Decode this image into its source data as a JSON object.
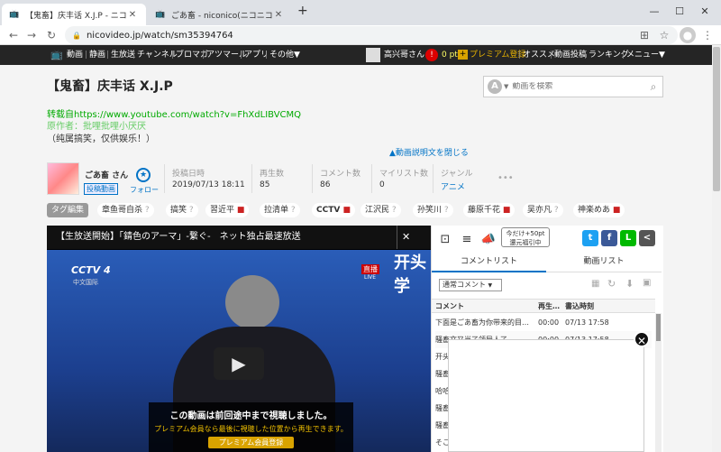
{
  "browser": {
    "tabs": [
      {
        "title": "【鬼畜】庆丰话 X.J.P - ニコニコ動画",
        "active": true
      },
      {
        "title": "ごあ畜 - niconico(ニコニコ)",
        "active": false
      }
    ],
    "new_tab": "+",
    "url": "nicovideo.jp/watch/sm35394764"
  },
  "nico_header": {
    "nav": [
      "動画",
      "静画",
      "生放送",
      "チャンネル",
      "ブロマガ",
      "アツマール",
      "アプリ",
      "その他▼"
    ],
    "user": "高兴哥さん",
    "points": "0 pt",
    "premium": "プレミアム登録",
    "right_nav": [
      "オススメ",
      "動画投稿",
      "ランキング",
      "メニュー▼"
    ]
  },
  "video": {
    "title": "【鬼畜】庆丰话 X.J.P",
    "search_placeholder": "動画を検索",
    "desc_source": "转载自https://www.youtube.com/watch?v=FhXdLIBVCMQ",
    "desc_author": "原作者：批哩批哩小厌厌",
    "desc_note": "（纯属搞笑，仅供娱乐！）",
    "close_desc": "▲動画説明文を閉じる"
  },
  "uploader": {
    "name": "ごあ畜 さん",
    "badge": "投稿動画",
    "follow": "フォロー"
  },
  "stats": [
    {
      "label": "投稿日時",
      "value": "2019/07/13 18:11"
    },
    {
      "label": "再生数",
      "value": "85"
    },
    {
      "label": "コメント数",
      "value": "86"
    },
    {
      "label": "マイリスト数",
      "value": "0"
    },
    {
      "label": "ジャンル",
      "value": "アニメ"
    }
  ],
  "more": "•••",
  "tags": {
    "edit_label": "タグ編集",
    "items": [
      {
        "label": "章鱼哥自杀",
        "lock": false
      },
      {
        "label": "搞笑",
        "lock": false
      },
      {
        "label": "習近平",
        "lock": true
      },
      {
        "label": "拉清单",
        "lock": false
      },
      {
        "label": "CCTV",
        "lock": true
      },
      {
        "label": "江沢民",
        "lock": false
      },
      {
        "label": "孙笑川",
        "lock": false
      },
      {
        "label": "藤原千花",
        "lock": true
      },
      {
        "label": "吴亦凡",
        "lock": false
      },
      {
        "label": "神楽めあ",
        "lock": true
      }
    ]
  },
  "player": {
    "banner": "【生放送開始】「錆色のアーマ」-繋ぐ-　ネット独占最速放送",
    "banner_close": "✕",
    "channel_logo": "CCTV 4",
    "channel_sub": "中文国际",
    "live_label": "直播",
    "live_sub": "LIVE",
    "overlay_text": "开头学",
    "resume_title": "この動画は前回途中まで視聴しました。",
    "resume_sub": "プレミアム会員なら最後に視聴した位置から再生できます。",
    "resume_button": "プレミアム会員登録"
  },
  "side_panel": {
    "promo": "今だけ+50pt\n還元福引中",
    "share_icons": [
      "twitter-icon",
      "facebook-icon",
      "line-icon",
      "share-icon"
    ],
    "tabs": [
      "コメントリスト",
      "動画リスト"
    ],
    "filter": "通常コメント",
    "columns": [
      "コメント",
      "再生…",
      "書込時刻"
    ],
    "rows": [
      {
        "comment": "下面是ごあ畜为你带来的目…",
        "time": "00:00",
        "date": "07/13 17:58"
      },
      {
        "comment": "騒畜文又当了领导人了",
        "time": "00:00",
        "date": "07/13 17:58"
      },
      {
        "comment": "开头",
        "time": "",
        "date": ""
      },
      {
        "comment": "騒畜",
        "time": "",
        "date": ""
      },
      {
        "comment": "哈哈",
        "time": "",
        "date": ""
      },
      {
        "comment": "騒畜",
        "time": "",
        "date": ""
      },
      {
        "comment": "騒畜",
        "time": "",
        "date": ""
      },
      {
        "comment": "そこ",
        "time": "",
        "date": ""
      }
    ],
    "popup_close": "✕"
  }
}
